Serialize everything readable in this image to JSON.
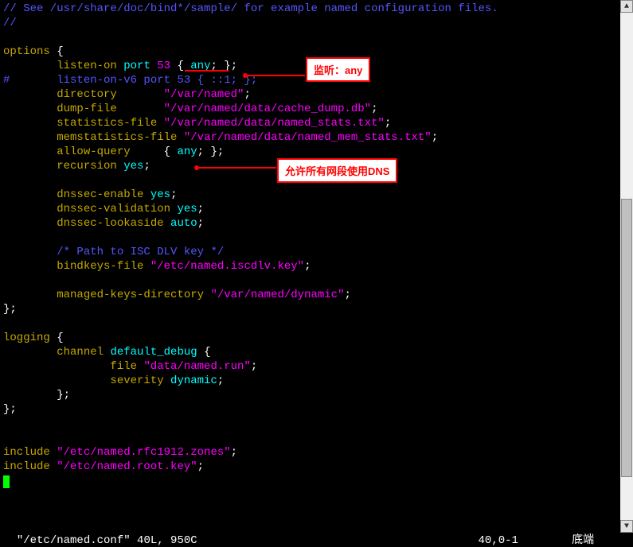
{
  "lines": [
    {
      "segments": [
        {
          "cls": "blue",
          "text": "// See /usr/share/doc/bind*/sample/ for example named configuration files."
        }
      ]
    },
    {
      "segments": [
        {
          "cls": "blue",
          "text": "//"
        }
      ]
    },
    {
      "segments": []
    },
    {
      "segments": [
        {
          "cls": "yellow",
          "text": "options "
        },
        {
          "cls": "white",
          "text": "{"
        }
      ]
    },
    {
      "segments": [
        {
          "cls": "white",
          "text": "        "
        },
        {
          "cls": "yellow",
          "text": "listen-on "
        },
        {
          "cls": "cyan",
          "text": "port "
        },
        {
          "cls": "magenta",
          "text": "53 "
        },
        {
          "cls": "white",
          "text": "{ "
        },
        {
          "cls": "cyan",
          "text": "any"
        },
        {
          "cls": "white",
          "text": "; };"
        }
      ]
    },
    {
      "segments": [
        {
          "cls": "blue",
          "text": "#       listen-on-v6 port 53 { ::1; };"
        }
      ]
    },
    {
      "segments": [
        {
          "cls": "white",
          "text": "        "
        },
        {
          "cls": "yellow",
          "text": "directory       "
        },
        {
          "cls": "magenta",
          "text": "\"/var/named\""
        },
        {
          "cls": "white",
          "text": ";"
        }
      ]
    },
    {
      "segments": [
        {
          "cls": "white",
          "text": "        "
        },
        {
          "cls": "yellow",
          "text": "dump-file       "
        },
        {
          "cls": "magenta",
          "text": "\"/var/named/data/cache_dump.db\""
        },
        {
          "cls": "white",
          "text": ";"
        }
      ]
    },
    {
      "segments": [
        {
          "cls": "white",
          "text": "        "
        },
        {
          "cls": "yellow",
          "text": "statistics-file "
        },
        {
          "cls": "magenta",
          "text": "\"/var/named/data/named_stats.txt\""
        },
        {
          "cls": "white",
          "text": ";"
        }
      ]
    },
    {
      "segments": [
        {
          "cls": "white",
          "text": "        "
        },
        {
          "cls": "yellow",
          "text": "memstatistics-file "
        },
        {
          "cls": "magenta",
          "text": "\"/var/named/data/named_mem_stats.txt\""
        },
        {
          "cls": "white",
          "text": ";"
        }
      ]
    },
    {
      "segments": [
        {
          "cls": "white",
          "text": "        "
        },
        {
          "cls": "yellow",
          "text": "allow-query     "
        },
        {
          "cls": "white",
          "text": "{ "
        },
        {
          "cls": "cyan",
          "text": "any"
        },
        {
          "cls": "white",
          "text": "; };"
        }
      ]
    },
    {
      "segments": [
        {
          "cls": "white",
          "text": "        "
        },
        {
          "cls": "yellow",
          "text": "recursion "
        },
        {
          "cls": "cyan",
          "text": "yes"
        },
        {
          "cls": "white",
          "text": ";"
        }
      ]
    },
    {
      "segments": []
    },
    {
      "segments": [
        {
          "cls": "white",
          "text": "        "
        },
        {
          "cls": "yellow",
          "text": "dnssec-enable "
        },
        {
          "cls": "cyan",
          "text": "yes"
        },
        {
          "cls": "white",
          "text": ";"
        }
      ]
    },
    {
      "segments": [
        {
          "cls": "white",
          "text": "        "
        },
        {
          "cls": "yellow",
          "text": "dnssec-validation "
        },
        {
          "cls": "cyan",
          "text": "yes"
        },
        {
          "cls": "white",
          "text": ";"
        }
      ]
    },
    {
      "segments": [
        {
          "cls": "white",
          "text": "        "
        },
        {
          "cls": "yellow",
          "text": "dnssec-lookaside "
        },
        {
          "cls": "cyan",
          "text": "auto"
        },
        {
          "cls": "white",
          "text": ";"
        }
      ]
    },
    {
      "segments": []
    },
    {
      "segments": [
        {
          "cls": "blue",
          "text": "        /* Path to ISC DLV key */"
        }
      ]
    },
    {
      "segments": [
        {
          "cls": "white",
          "text": "        "
        },
        {
          "cls": "yellow",
          "text": "bindkeys-file "
        },
        {
          "cls": "magenta",
          "text": "\"/etc/named.iscdlv.key\""
        },
        {
          "cls": "white",
          "text": ";"
        }
      ]
    },
    {
      "segments": []
    },
    {
      "segments": [
        {
          "cls": "white",
          "text": "        "
        },
        {
          "cls": "yellow",
          "text": "managed-keys-directory "
        },
        {
          "cls": "magenta",
          "text": "\"/var/named/dynamic\""
        },
        {
          "cls": "white",
          "text": ";"
        }
      ]
    },
    {
      "segments": [
        {
          "cls": "white",
          "text": "};"
        }
      ]
    },
    {
      "segments": []
    },
    {
      "segments": [
        {
          "cls": "yellow",
          "text": "logging "
        },
        {
          "cls": "white",
          "text": "{"
        }
      ]
    },
    {
      "segments": [
        {
          "cls": "white",
          "text": "        "
        },
        {
          "cls": "yellow",
          "text": "channel "
        },
        {
          "cls": "cyan",
          "text": "default_debug "
        },
        {
          "cls": "white",
          "text": "{"
        }
      ]
    },
    {
      "segments": [
        {
          "cls": "white",
          "text": "                "
        },
        {
          "cls": "yellow",
          "text": "file "
        },
        {
          "cls": "magenta",
          "text": "\"data/named.run\""
        },
        {
          "cls": "white",
          "text": ";"
        }
      ]
    },
    {
      "segments": [
        {
          "cls": "white",
          "text": "                "
        },
        {
          "cls": "yellow",
          "text": "severity "
        },
        {
          "cls": "cyan",
          "text": "dynamic"
        },
        {
          "cls": "white",
          "text": ";"
        }
      ]
    },
    {
      "segments": [
        {
          "cls": "white",
          "text": "        };"
        }
      ]
    },
    {
      "segments": [
        {
          "cls": "white",
          "text": "};"
        }
      ]
    },
    {
      "segments": []
    },
    {
      "segments": []
    },
    {
      "segments": [
        {
          "cls": "yellow",
          "text": "include "
        },
        {
          "cls": "magenta",
          "text": "\"/etc/named.rfc1912.zones\""
        },
        {
          "cls": "white",
          "text": ";"
        }
      ]
    },
    {
      "segments": [
        {
          "cls": "yellow",
          "text": "include "
        },
        {
          "cls": "magenta",
          "text": "\"/etc/named.root.key\""
        },
        {
          "cls": "white",
          "text": ";"
        }
      ]
    }
  ],
  "annotations": {
    "box1_text": "监听：any",
    "box2_text": "允许所有网段使用DNS"
  },
  "status": {
    "filename": "\"/etc/named.conf\"",
    "filestats": "40L, 950C",
    "position": "40,0-1",
    "label": "底端"
  }
}
